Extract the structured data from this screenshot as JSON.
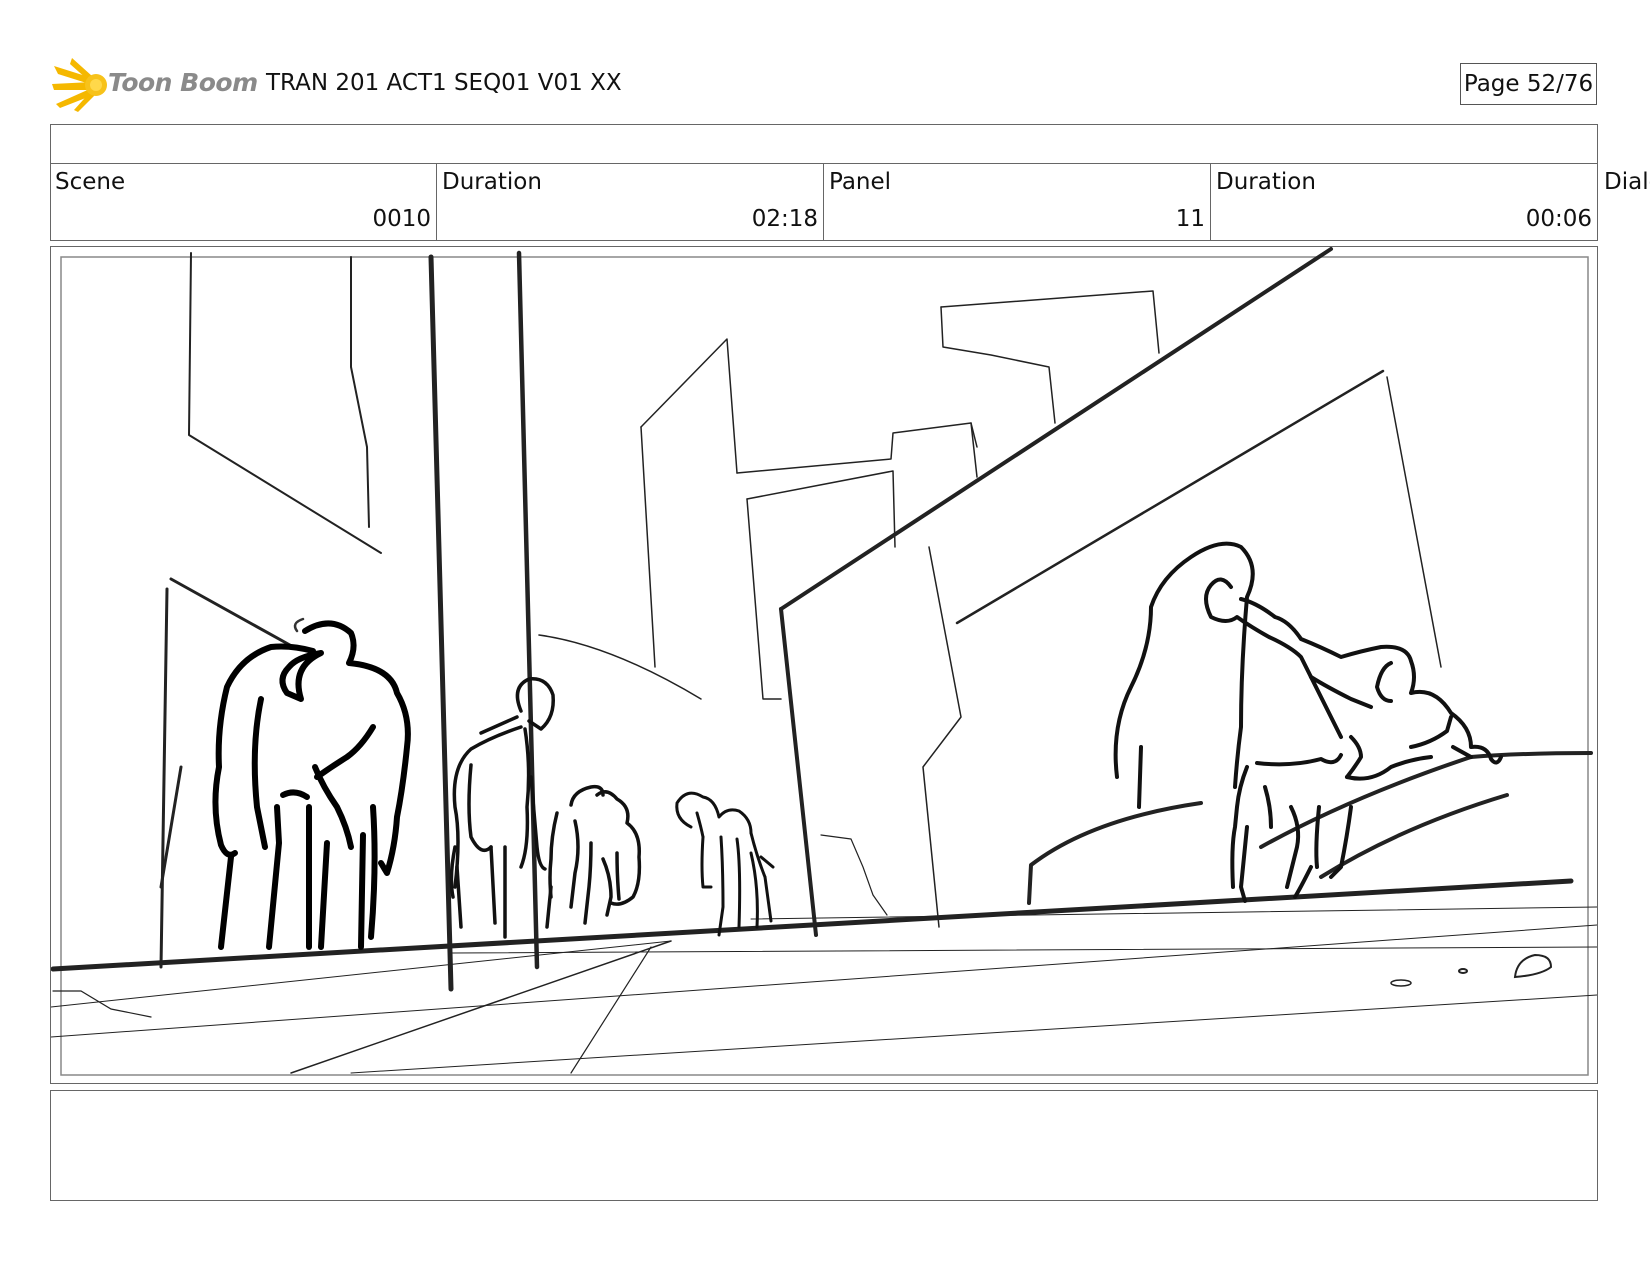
{
  "header": {
    "logo_text": "Toon Boom",
    "doc_title": "TRAN 201 ACT1 SEQ01 V01 XX",
    "page_label": "Page 52/76"
  },
  "info": {
    "scene_label": "Scene",
    "scene_value": "0010",
    "scene_duration_label": "Duration",
    "scene_duration_value": "02:18",
    "panel_label": "Panel",
    "panel_value": "11",
    "panel_duration_label": "Duration",
    "panel_duration_value": "00:06",
    "dialog_label": "Dialo"
  },
  "colors": {
    "logo_star": "#f5b800",
    "logo_text": "#8a8a8a",
    "border": "#666666",
    "sketch": "#1a1a1a"
  }
}
